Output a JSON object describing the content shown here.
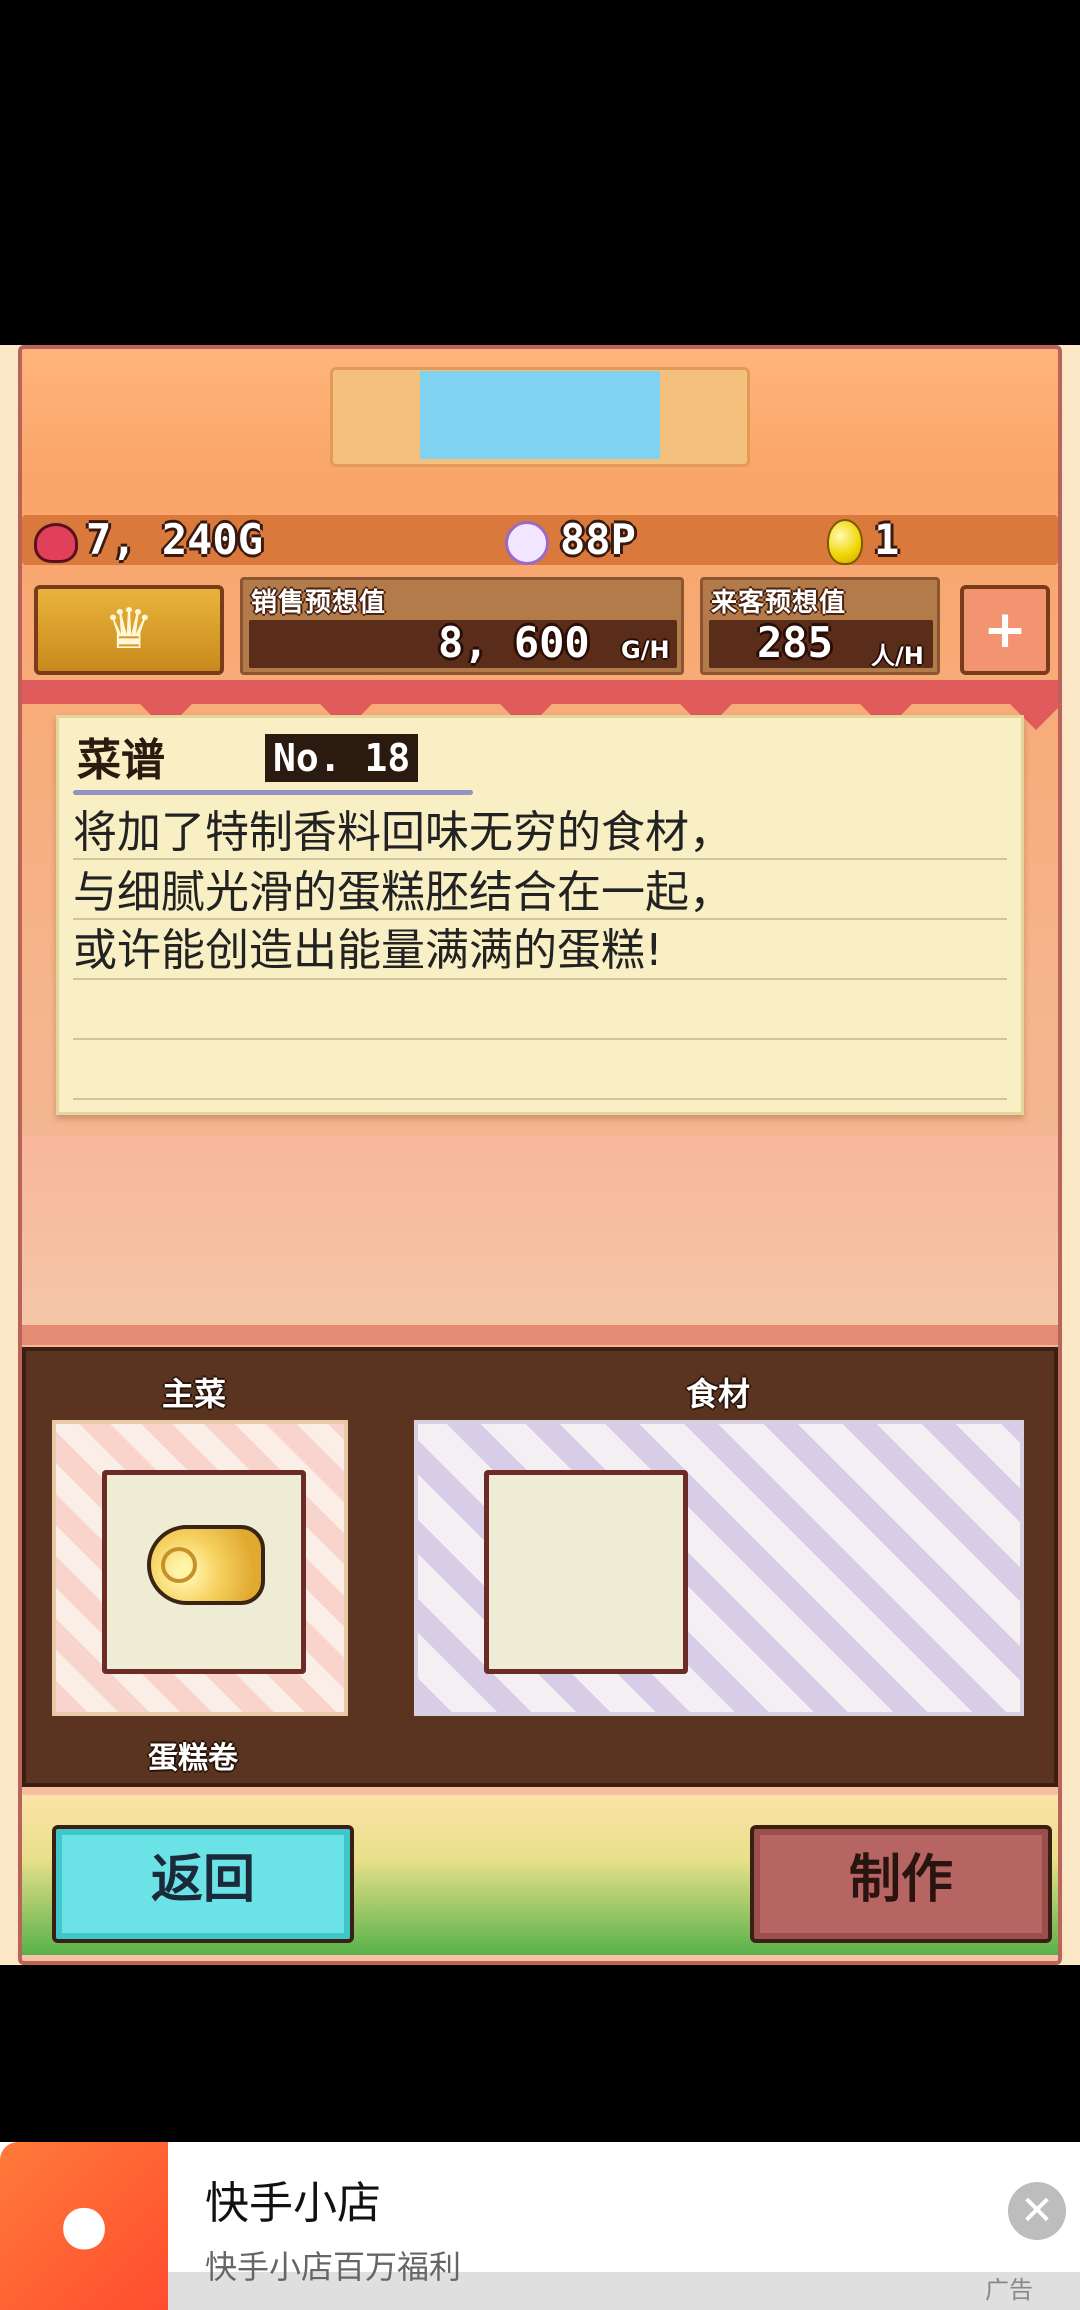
{
  "stats": {
    "gold": "7, 240G",
    "points": "88P",
    "eggs": "1"
  },
  "sales_panel": {
    "label": "销售预想值",
    "value": "8, 600",
    "unit": "G/H"
  },
  "visitor_panel": {
    "label": "来客预想值",
    "value": "285",
    "unit": "人/H"
  },
  "recipe": {
    "title": "菜谱",
    "number": "No. 18",
    "lines": [
      "将加了特制香料回味无穷的食材，",
      "与细腻光滑的蛋糕胚结合在一起，",
      "或许能创造出能量满满的蛋糕!"
    ]
  },
  "ingredients": {
    "main_label": "主菜",
    "ingredient_label": "食材",
    "main_item_name": "蛋糕卷"
  },
  "buttons": {
    "back": "返回",
    "make": "制作"
  },
  "ad": {
    "title": "快手小店",
    "subtitle": "快手小店百万福利",
    "tag": "广告"
  },
  "colors": {
    "back_button": "#6be3e6",
    "make_button": "#b66563",
    "banner_red": "#e05b5b",
    "wood": "#5a3420"
  },
  "icons": [
    "coin-purse-icon",
    "smiley-icon",
    "golden-egg-icon",
    "crown-icon",
    "add-customer-icon",
    "cake-roll-icon",
    "close-icon"
  ]
}
